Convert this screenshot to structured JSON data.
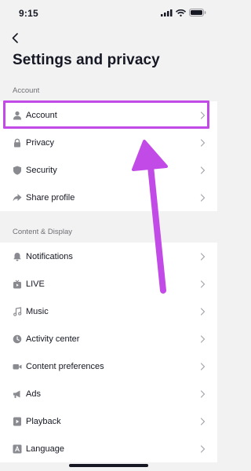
{
  "status": {
    "time": "9:15"
  },
  "header": {
    "title": "Settings and privacy"
  },
  "sections": [
    {
      "label": "Account",
      "items": [
        {
          "label": "Account",
          "icon": "person-icon"
        },
        {
          "label": "Privacy",
          "icon": "lock-icon"
        },
        {
          "label": "Security",
          "icon": "shield-icon"
        },
        {
          "label": "Share profile",
          "icon": "share-icon"
        }
      ]
    },
    {
      "label": "Content & Display",
      "items": [
        {
          "label": "Notifications",
          "icon": "bell-icon"
        },
        {
          "label": "LIVE",
          "icon": "live-tv-icon"
        },
        {
          "label": "Music",
          "icon": "music-note-icon"
        },
        {
          "label": "Activity center",
          "icon": "clock-icon"
        },
        {
          "label": "Content preferences",
          "icon": "video-camera-icon"
        },
        {
          "label": "Ads",
          "icon": "megaphone-icon"
        },
        {
          "label": "Playback",
          "icon": "play-icon"
        },
        {
          "label": "Language",
          "icon": "language-icon"
        }
      ]
    }
  ],
  "colors": {
    "highlight": "#c24ae6",
    "background": "#f2f2f3",
    "icon": "#8a8b91"
  }
}
